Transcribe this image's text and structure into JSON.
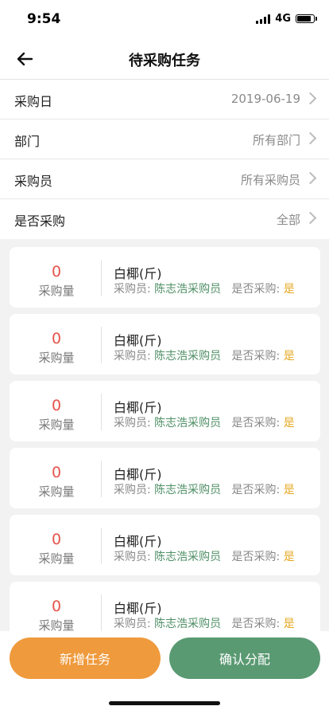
{
  "status_bar": {
    "time": "9:54",
    "network": "4G",
    "battery_level": 0.85
  },
  "header": {
    "title": "待采购任务",
    "back_icon": "arrow-left-icon"
  },
  "filters": [
    {
      "label": "采购日",
      "value": "2019-06-19"
    },
    {
      "label": "部门",
      "value": "所有部门"
    },
    {
      "label": "采购员",
      "value": "所有采购员"
    },
    {
      "label": "是否采购",
      "value": "全部"
    }
  ],
  "tasks": [
    {
      "quantity": "0",
      "quantity_label": "采购量",
      "item": "白椰(斤)",
      "buyer_label": "采购员:",
      "buyer": "陈志浩采购员",
      "purchased_label": "是否采购:",
      "purchased": "是"
    },
    {
      "quantity": "0",
      "quantity_label": "采购量",
      "item": "白椰(斤)",
      "buyer_label": "采购员:",
      "buyer": "陈志浩采购员",
      "purchased_label": "是否采购:",
      "purchased": "是"
    },
    {
      "quantity": "0",
      "quantity_label": "采购量",
      "item": "白椰(斤)",
      "buyer_label": "采购员:",
      "buyer": "陈志浩采购员",
      "purchased_label": "是否采购:",
      "purchased": "是"
    },
    {
      "quantity": "0",
      "quantity_label": "采购量",
      "item": "白椰(斤)",
      "buyer_label": "采购员:",
      "buyer": "陈志浩采购员",
      "purchased_label": "是否采购:",
      "purchased": "是"
    },
    {
      "quantity": "0",
      "quantity_label": "采购量",
      "item": "白椰(斤)",
      "buyer_label": "采购员:",
      "buyer": "陈志浩采购员",
      "purchased_label": "是否采购:",
      "purchased": "是"
    },
    {
      "quantity": "0",
      "quantity_label": "采购量",
      "item": "白椰(斤)",
      "buyer_label": "采购员:",
      "buyer": "陈志浩采购员",
      "purchased_label": "是否采购:",
      "purchased": "是"
    }
  ],
  "actions": {
    "add_task": "新增任务",
    "confirm_assign": "确认分配"
  },
  "colors": {
    "quantity": "#e5534b",
    "buyer": "#4f8f66",
    "purchased": "#e6a822",
    "add_button": "#ef9a3c",
    "confirm_button": "#5a9a73"
  }
}
